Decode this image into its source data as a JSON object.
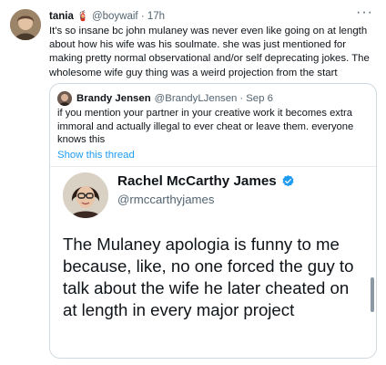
{
  "tweet": {
    "author_name": "tania",
    "emoji": "🧯",
    "handle": "@boywaif",
    "separator": "·",
    "time": "17h",
    "more_icon": "more-horizontal-icon",
    "text": "It's so insane bc john mulaney was never even like going on at length about how his wife was his soulmate. she was just mentioned for making pretty normal observational and/or self deprecating jokes. The wholesome wife guy thing was a weird projection from the start"
  },
  "quote": {
    "author_name": "Brandy Jensen",
    "handle": "@BrandyLJensen",
    "separator": "·",
    "date": "Sep 6",
    "text": "if you mention your partner in your creative work it becomes extra immoral and actually illegal to ever cheat or leave them. everyone knows this",
    "show_thread": "Show this thread"
  },
  "embedded_card": {
    "author_name": "Rachel McCarthy James",
    "handle": "@rmccarthyjames",
    "verified_icon": "verified-badge-icon",
    "text": "The Mulaney apologia is funny to me because, like, no one forced the guy to talk about the wife he later cheated on at length in every major project"
  },
  "colors": {
    "link": "#1d9bf0",
    "secondary_text": "#536471",
    "border": "#cfd9de",
    "verified": "#1d9bf0"
  }
}
